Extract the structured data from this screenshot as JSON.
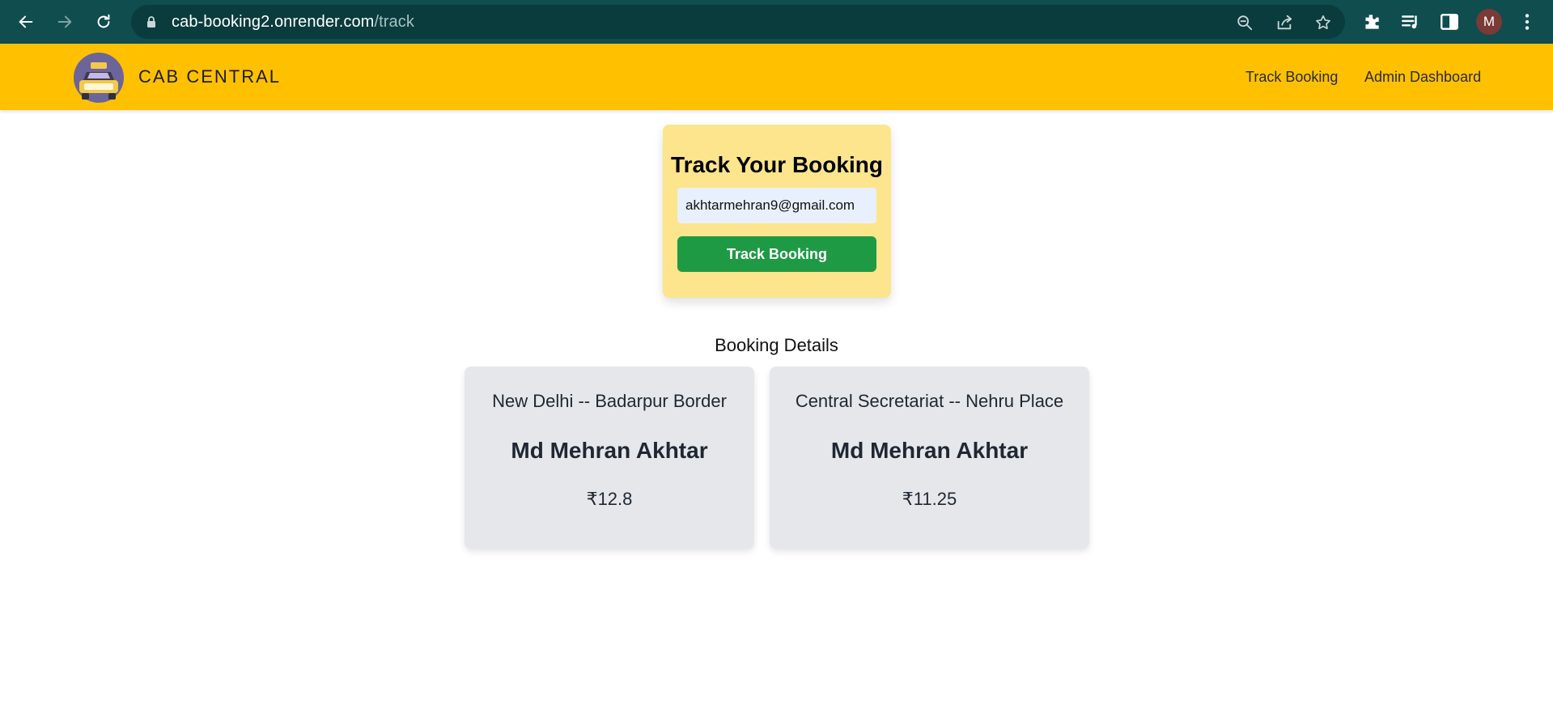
{
  "browser": {
    "url_host": "cab-booking2.onrender.com",
    "url_path": "/track",
    "profile_initial": "M",
    "icons": [
      "back-arrow-icon",
      "forward-arrow-icon",
      "reload-icon",
      "lock-icon",
      "zoom-icon",
      "share-icon",
      "star-icon",
      "extensions-icon",
      "media-icon",
      "side-panel-icon",
      "kebab-menu-icon"
    ]
  },
  "header": {
    "brand": "CAB CENTRAL",
    "nav": [
      "Track Booking",
      "Admin Dashboard"
    ],
    "background": "#ffc000"
  },
  "track": {
    "title": "Track Your Booking",
    "email_value": "akhtarmehran9@gmail.com",
    "button_label": "Track Booking",
    "card_color": "#fce58c",
    "button_color": "#1e9a44"
  },
  "details": {
    "heading": "Booking Details",
    "bookings": [
      {
        "route": "New Delhi -- Badarpur Border",
        "name": "Md Mehran Akhtar",
        "fare": "₹12.8"
      },
      {
        "route": "Central Secretariat -- Nehru Place",
        "name": "Md Mehran Akhtar",
        "fare": "₹11.25"
      }
    ]
  }
}
